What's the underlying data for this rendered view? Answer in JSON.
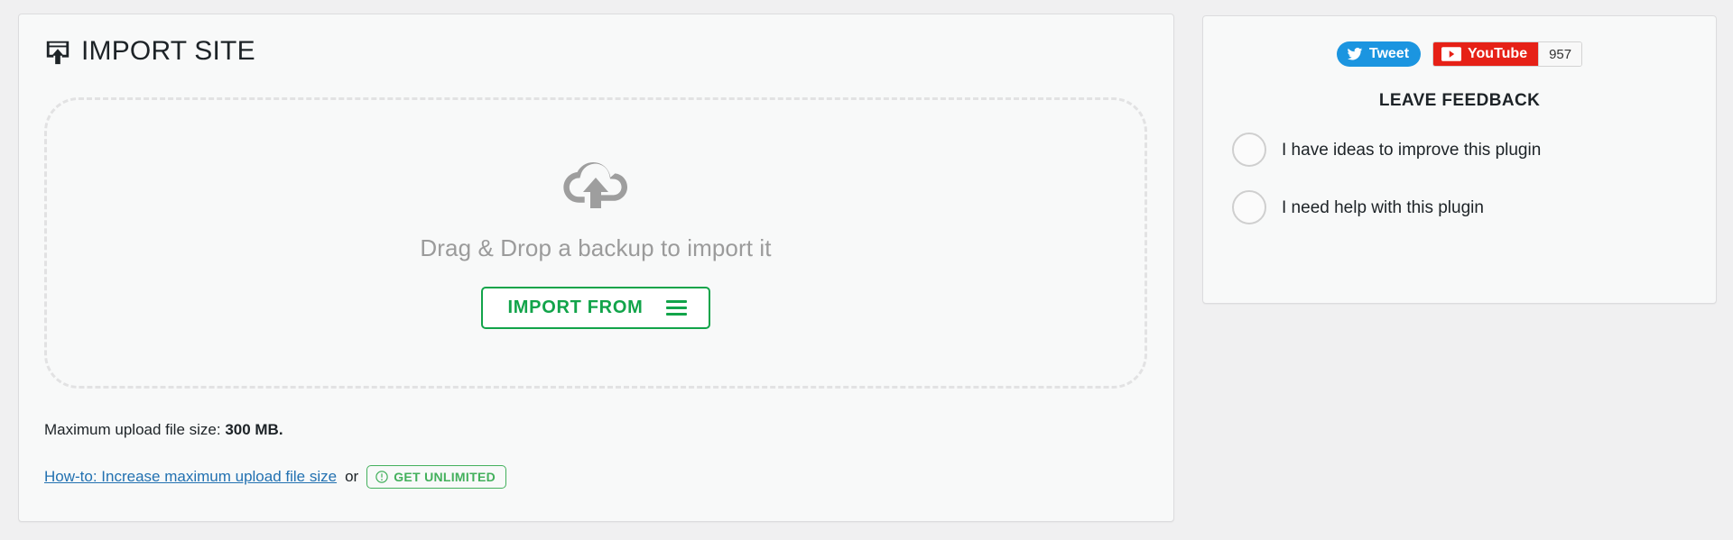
{
  "left_panel": {
    "title": "IMPORT SITE",
    "title_icon": "import-site-browser-upload-icon",
    "dropzone": {
      "icon": "cloud-upload-icon",
      "text": "Drag & Drop a backup to import it",
      "button_label": "IMPORT FROM",
      "button_icon": "hamburger-menu-icon"
    },
    "max_upload": {
      "label": "Maximum upload file size:",
      "value": "300 MB."
    },
    "howto": {
      "link_text": "How-to: Increase maximum upload file size",
      "separator": "or",
      "badge_label": "GET UNLIMITED",
      "badge_icon": "exclamation-circle-icon"
    }
  },
  "right_panel": {
    "social": {
      "tweet_label": "Tweet",
      "tweet_icon": "twitter-bird-icon",
      "youtube_label": "YouTube",
      "youtube_icon": "youtube-play-icon",
      "youtube_count": "957"
    },
    "feedback": {
      "title": "LEAVE FEEDBACK",
      "options": [
        {
          "label": "I have ideas to improve this plugin"
        },
        {
          "label": "I need help with this plugin"
        }
      ]
    }
  },
  "colors": {
    "green": "#12a44a",
    "badge_green": "#43b05c",
    "link_blue": "#2271b1",
    "twitter_blue": "#1b95e0",
    "youtube_red": "#e62117",
    "page_bg": "#f0f0f1",
    "panel_bg": "#f8f9f9"
  }
}
